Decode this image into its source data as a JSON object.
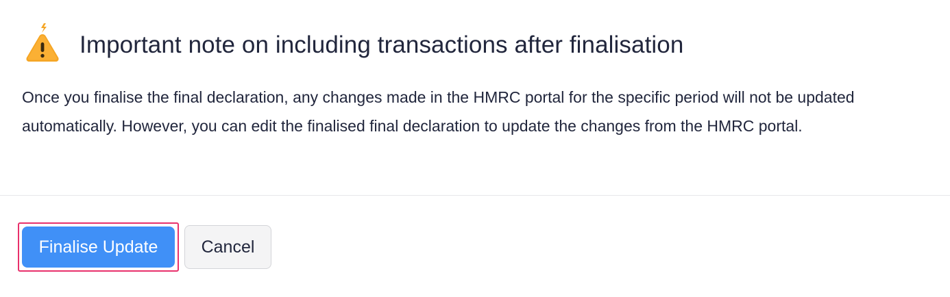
{
  "dialog": {
    "icon": "warning-triangle-icon",
    "title": "Important note on including transactions after finalisation",
    "message": "Once you finalise the final declaration, any changes made in the HMRC portal for the specific period will not be updated automatically. However, you can edit the finalised final declaration to update the changes from the HMRC portal."
  },
  "footer": {
    "primary_label": "Finalise Update",
    "secondary_label": "Cancel"
  },
  "colors": {
    "primary": "#4090f7",
    "focus_ring": "#e8306b",
    "warning": "#f5a524",
    "text": "#21263c",
    "secondary_bg": "#f4f4f5"
  }
}
